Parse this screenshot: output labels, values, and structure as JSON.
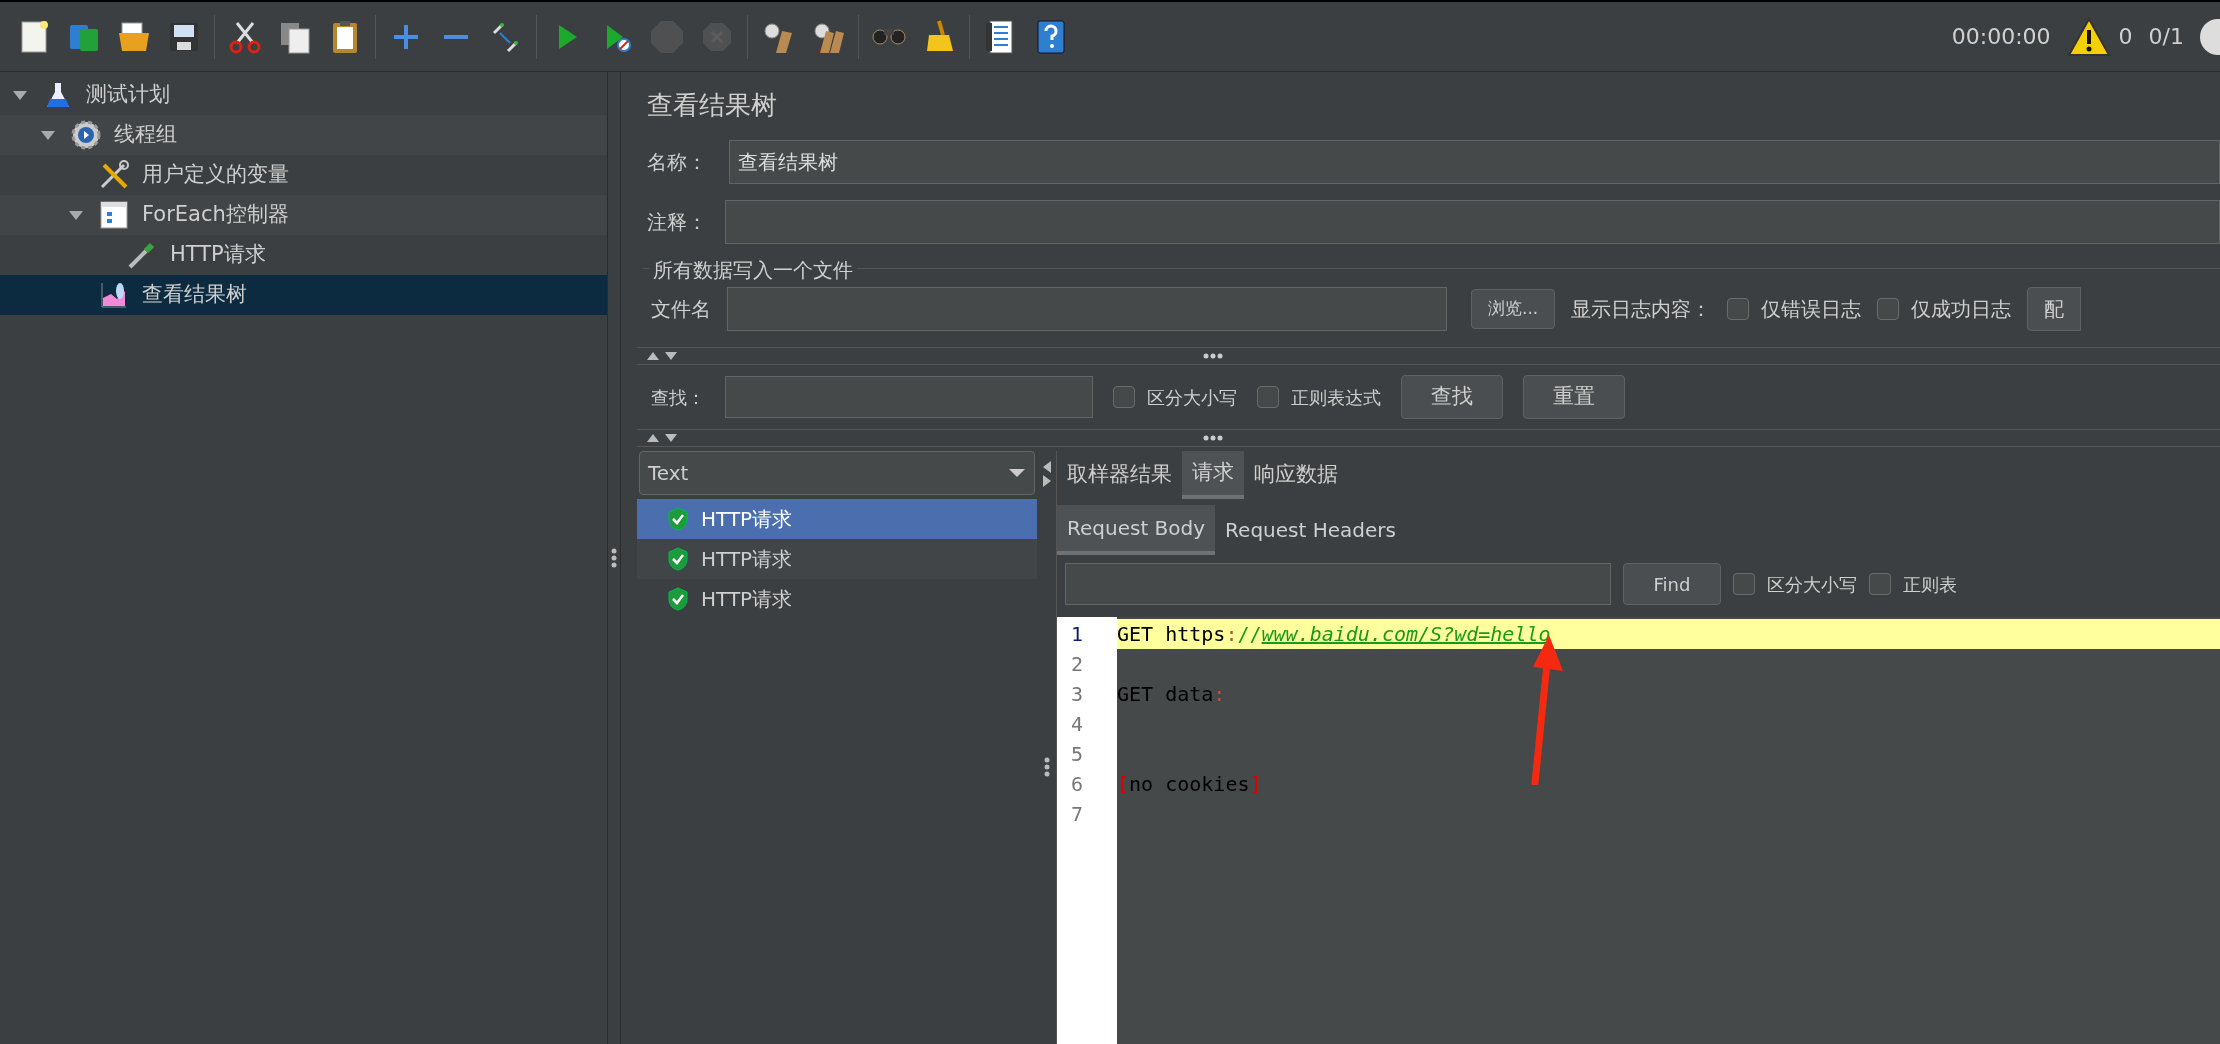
{
  "toolbar": {
    "groups": [
      [
        {
          "kind": "new",
          "disabled": false
        },
        {
          "kind": "templates",
          "disabled": false
        },
        {
          "kind": "open",
          "disabled": false
        },
        {
          "kind": "save",
          "disabled": false
        }
      ],
      [
        {
          "kind": "cut",
          "disabled": false
        },
        {
          "kind": "copy",
          "disabled": false
        },
        {
          "kind": "paste",
          "disabled": false
        }
      ],
      [
        {
          "kind": "expand",
          "disabled": false
        },
        {
          "kind": "collapse",
          "disabled": false
        },
        {
          "kind": "toggle",
          "disabled": false
        }
      ],
      [
        {
          "kind": "start",
          "disabled": false
        },
        {
          "kind": "start_no_pause",
          "disabled": false
        },
        {
          "kind": "stop",
          "disabled": true
        },
        {
          "kind": "shutdown",
          "disabled": true
        }
      ],
      [
        {
          "kind": "clear",
          "disabled": false
        },
        {
          "kind": "clear_all",
          "disabled": false
        }
      ],
      [
        {
          "kind": "search",
          "disabled": false
        },
        {
          "kind": "reset_search",
          "disabled": false
        }
      ],
      [
        {
          "kind": "function_helper",
          "disabled": false
        },
        {
          "kind": "help",
          "disabled": false
        }
      ]
    ],
    "timer": "00:00:00",
    "warnings": "0",
    "threads": "0/1"
  },
  "tree": [
    {
      "label": "测试计划",
      "kind": "plan",
      "expanded": true,
      "selected": false,
      "children": [
        {
          "label": "线程组",
          "kind": "thread_group",
          "expanded": true,
          "selected": false,
          "children": [
            {
              "label": "用户定义的变量",
              "kind": "config",
              "selected": false
            },
            {
              "label": "ForEach控制器",
              "kind": "controller",
              "expanded": true,
              "selected": false,
              "children": [
                {
                  "label": "HTTP请求",
                  "kind": "sampler",
                  "selected": false
                }
              ]
            },
            {
              "label": "查看结果树",
              "kind": "listener",
              "selected": true
            }
          ]
        }
      ]
    }
  ],
  "panel": {
    "title": "查看结果树",
    "name": {
      "label": "名称：",
      "value": "查看结果树"
    },
    "comment": {
      "label": "注释："
    },
    "file_group": {
      "legend": "所有数据写入一个文件",
      "file_label": "文件名",
      "browse": "浏览...",
      "log_label": "显示日志内容：",
      "options": [
        {
          "label": "仅错误日志",
          "checked": false
        },
        {
          "label": "仅成功日志",
          "checked": false
        }
      ],
      "config": "配"
    },
    "search": {
      "label": "查找：",
      "options": [
        {
          "label": "区分大小写",
          "checked": false
        },
        {
          "label": "正则表达式",
          "checked": false
        }
      ],
      "find": "查找",
      "reset": "重置"
    },
    "renderer": "Text",
    "results": [
      {
        "label": "HTTP请求",
        "selected": true
      },
      {
        "label": "HTTP请求",
        "selected": false
      },
      {
        "label": "HTTP请求",
        "selected": false
      }
    ],
    "tabs": [
      {
        "label": "取样器结果",
        "selected": false
      },
      {
        "label": "请求",
        "selected": true
      },
      {
        "label": "响应数据",
        "selected": false
      }
    ],
    "subtabs": [
      {
        "label": "Request Body",
        "selected": true
      },
      {
        "label": "Request Headers",
        "selected": false
      }
    ],
    "body_search": {
      "find": "Find",
      "options": [
        {
          "label": "区分大小写",
          "checked": false
        },
        {
          "label": "正则表",
          "checked": false
        }
      ]
    },
    "code": [
      {
        "number": "1",
        "highlighted": true,
        "segments": [
          {
            "text": "GET https",
            "kind": "plain"
          },
          {
            "text": ":",
            "kind": "punct"
          },
          {
            "text": "//",
            "kind": "slash"
          },
          {
            "text": "www.baidu.com/S?wd=hello",
            "kind": "link"
          }
        ]
      },
      {
        "number": "2",
        "highlighted": false
      },
      {
        "number": "3",
        "highlighted": false,
        "segments": [
          {
            "text": "GET data",
            "kind": "plain"
          },
          {
            "text": ":",
            "kind": "punct"
          }
        ]
      },
      {
        "number": "4",
        "highlighted": false
      },
      {
        "number": "5",
        "highlighted": false
      },
      {
        "number": "6",
        "highlighted": false,
        "segments": [
          {
            "text": "[",
            "kind": "bracket"
          },
          {
            "text": "no cookies",
            "kind": "plain"
          },
          {
            "text": "]",
            "kind": "bracket"
          }
        ]
      },
      {
        "number": "7",
        "highlighted": false
      }
    ]
  }
}
